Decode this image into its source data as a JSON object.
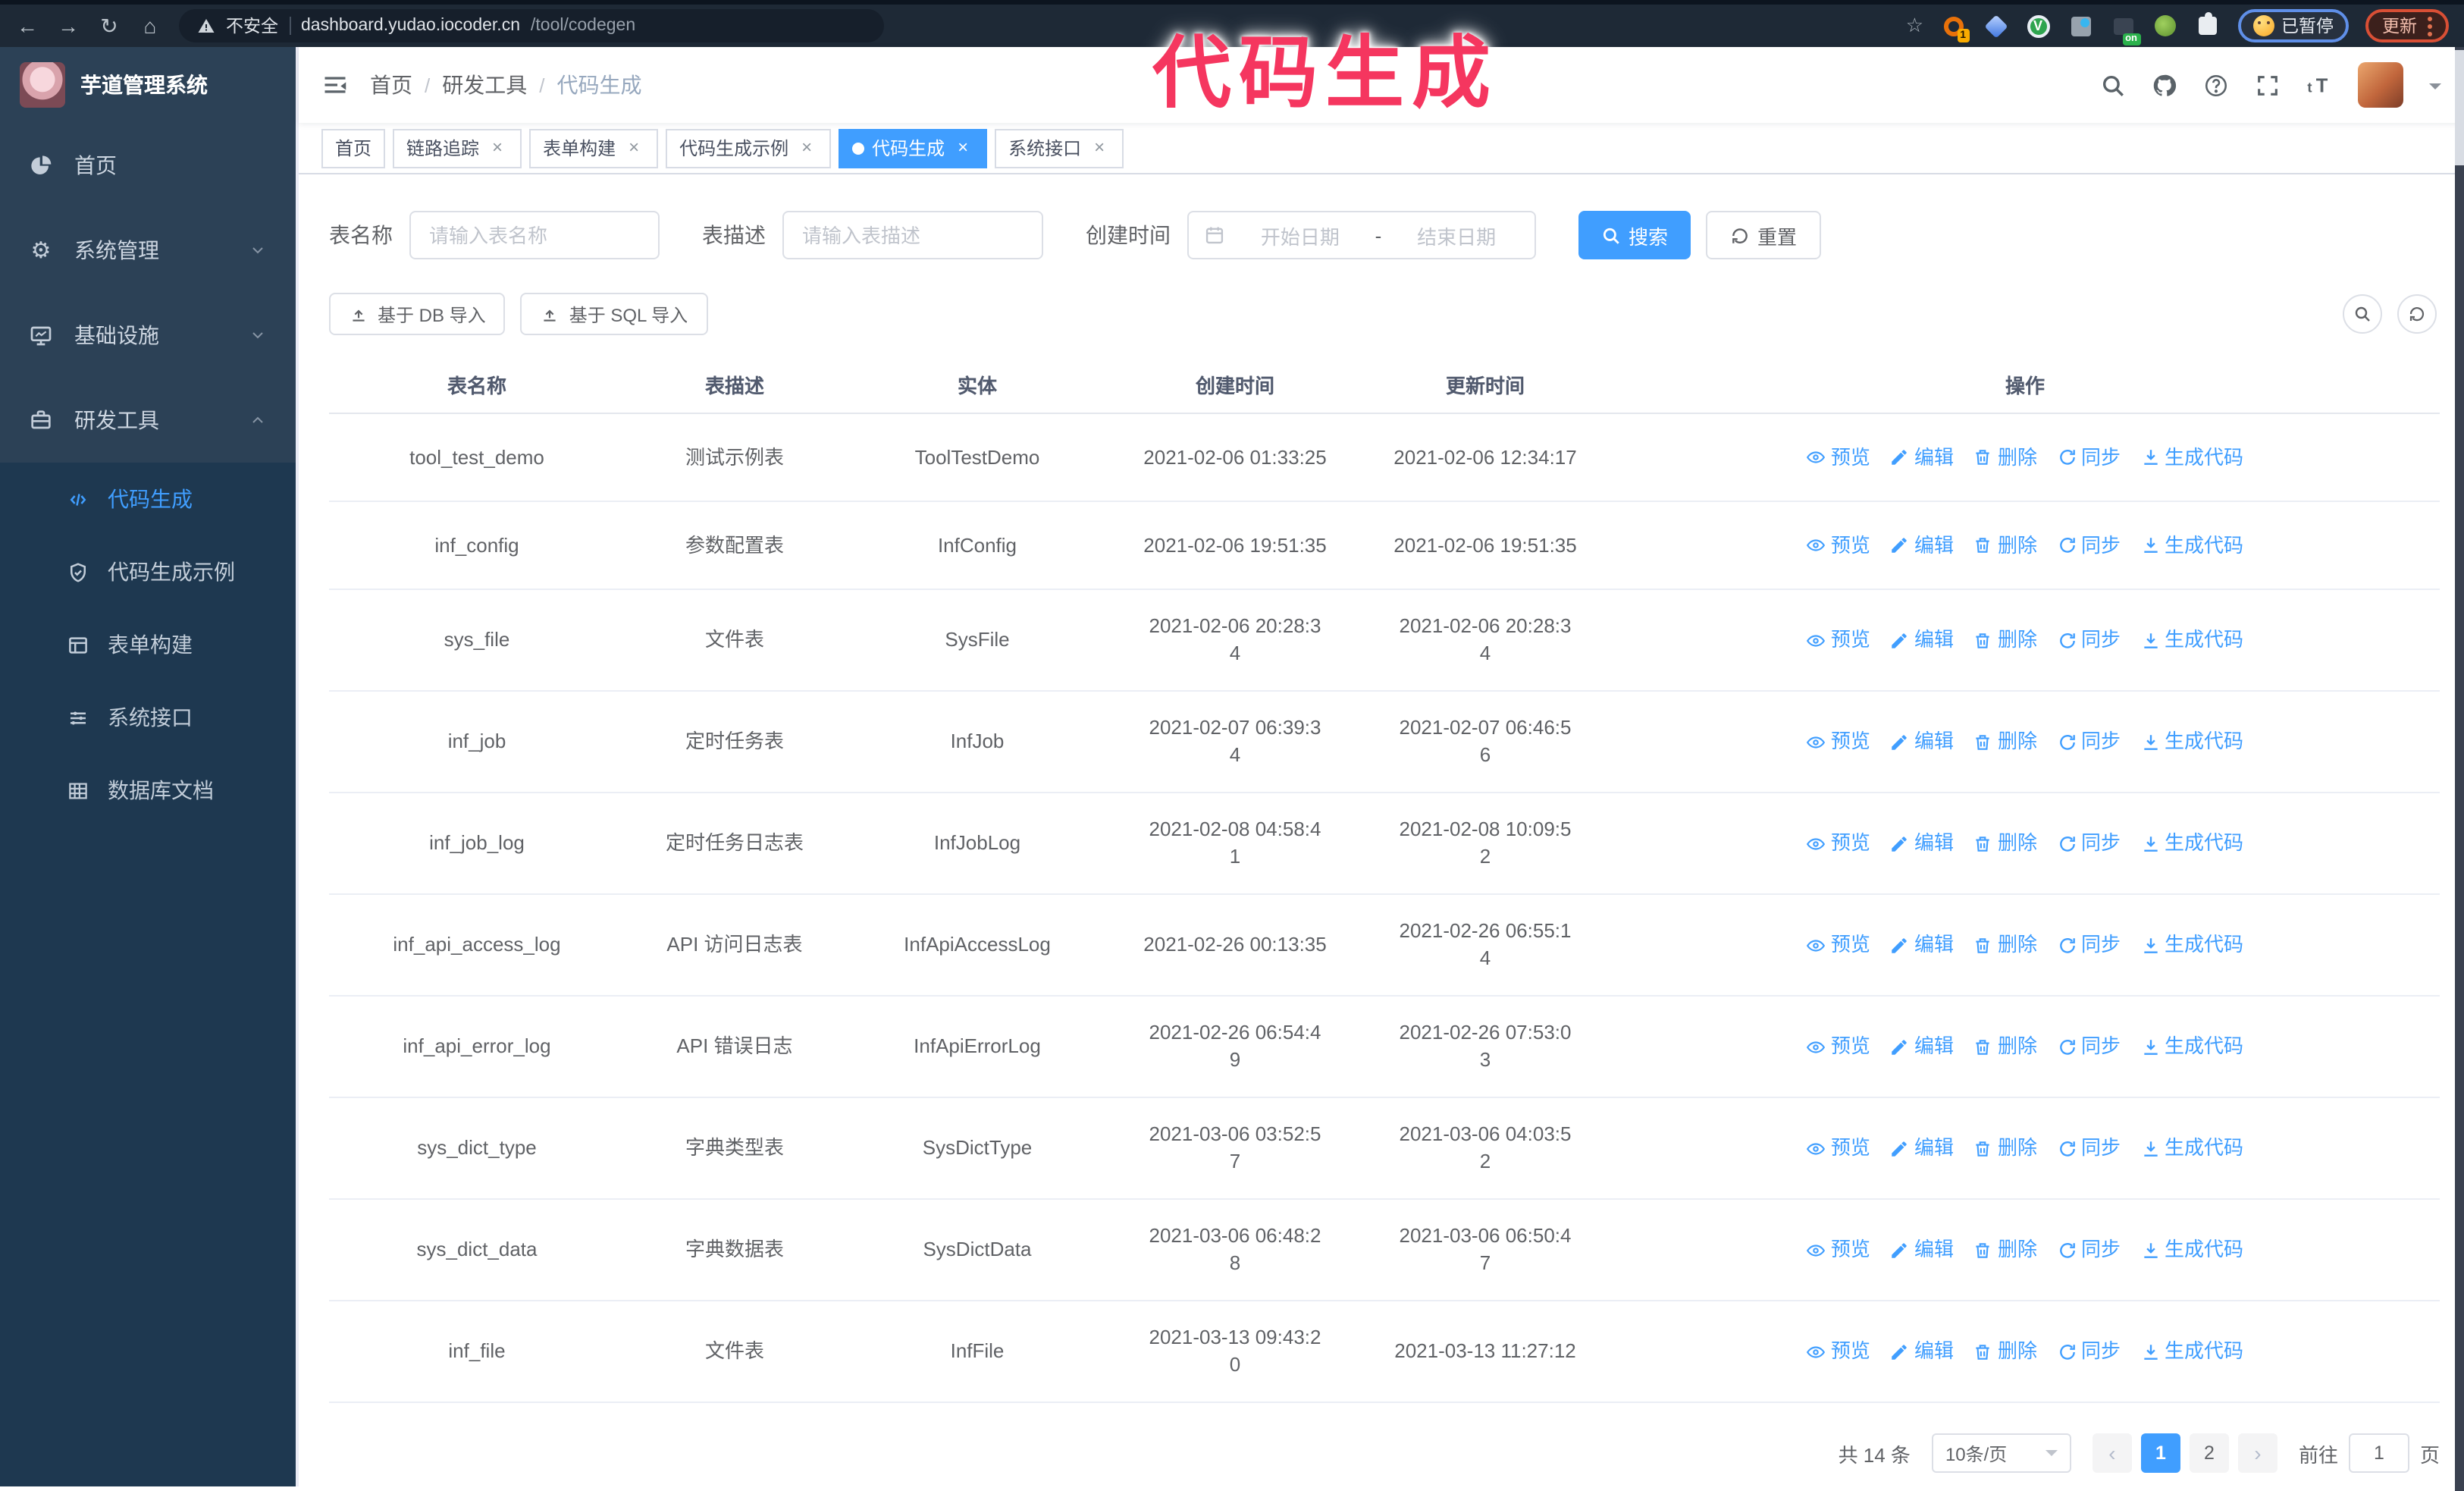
{
  "annotation": "代码生成",
  "browser": {
    "security_label": "不安全",
    "url_host": "dashboard.yudao.iocoder.cn",
    "url_path": "/tool/codegen",
    "extension_badge": "1",
    "extension_on_badge": "on",
    "paused_label": "已暂停",
    "update_label": "更新"
  },
  "sidebar": {
    "title": "芋道管理系统",
    "items": [
      {
        "label": "首页",
        "icon": "dashboard-icon"
      },
      {
        "label": "系统管理",
        "icon": "gear-icon",
        "chevron": "down"
      },
      {
        "label": "基础设施",
        "icon": "infra-icon",
        "chevron": "down"
      },
      {
        "label": "研发工具",
        "icon": "tools-icon",
        "chevron": "up"
      }
    ],
    "subitems": [
      {
        "label": "代码生成",
        "icon": "code-icon",
        "active": true
      },
      {
        "label": "代码生成示例",
        "icon": "example-icon"
      },
      {
        "label": "表单构建",
        "icon": "form-icon"
      },
      {
        "label": "系统接口",
        "icon": "api-icon"
      },
      {
        "label": "数据库文档",
        "icon": "dbdoc-icon"
      }
    ]
  },
  "header": {
    "breadcrumb": [
      "首页",
      "研发工具",
      "代码生成"
    ],
    "sep": "/"
  },
  "tabs": [
    {
      "label": "首页",
      "closable": false,
      "active": false
    },
    {
      "label": "链路追踪",
      "closable": true,
      "active": false
    },
    {
      "label": "表单构建",
      "closable": true,
      "active": false
    },
    {
      "label": "代码生成示例",
      "closable": true,
      "active": false
    },
    {
      "label": "代码生成",
      "closable": true,
      "active": true
    },
    {
      "label": "系统接口",
      "closable": true,
      "active": false
    }
  ],
  "filters": {
    "name_label": "表名称",
    "name_placeholder": "请输入表名称",
    "desc_label": "表描述",
    "desc_placeholder": "请输入表描述",
    "time_label": "创建时间",
    "start_placeholder": "开始日期",
    "range_separator": "-",
    "end_placeholder": "结束日期",
    "search_label": "搜索",
    "reset_label": "重置"
  },
  "toolbar": {
    "db_import_label": "基于 DB 导入",
    "sql_import_label": "基于 SQL 导入"
  },
  "table": {
    "columns": [
      "表名称",
      "表描述",
      "实体",
      "创建时间",
      "更新时间",
      "操作"
    ],
    "actions": [
      "预览",
      "编辑",
      "删除",
      "同步",
      "生成代码"
    ],
    "rows": [
      {
        "name": "tool_test_demo",
        "desc": "测试示例表",
        "entity": "ToolTestDemo",
        "created": "2021-02-06 01:33:25",
        "updated": "2021-02-06 12:34:17"
      },
      {
        "name": "inf_config",
        "desc": "参数配置表",
        "entity": "InfConfig",
        "created": "2021-02-06 19:51:35",
        "updated": "2021-02-06 19:51:35"
      },
      {
        "name": "sys_file",
        "desc": "文件表",
        "entity": "SysFile",
        "created": "2021-02-06 20:28:3\n4",
        "updated": "2021-02-06 20:28:3\n4"
      },
      {
        "name": "inf_job",
        "desc": "定时任务表",
        "entity": "InfJob",
        "created": "2021-02-07 06:39:3\n4",
        "updated": "2021-02-07 06:46:5\n6"
      },
      {
        "name": "inf_job_log",
        "desc": "定时任务日志表",
        "entity": "InfJobLog",
        "created": "2021-02-08 04:58:4\n1",
        "updated": "2021-02-08 10:09:5\n2"
      },
      {
        "name": "inf_api_access_log",
        "desc": "API 访问日志表",
        "entity": "InfApiAccessLog",
        "created": "2021-02-26 00:13:35",
        "updated": "2021-02-26 06:55:1\n4"
      },
      {
        "name": "inf_api_error_log",
        "desc": "API 错误日志",
        "entity": "InfApiErrorLog",
        "created": "2021-02-26 06:54:4\n9",
        "updated": "2021-02-26 07:53:0\n3"
      },
      {
        "name": "sys_dict_type",
        "desc": "字典类型表",
        "entity": "SysDictType",
        "created": "2021-03-06 03:52:5\n7",
        "updated": "2021-03-06 04:03:5\n2"
      },
      {
        "name": "sys_dict_data",
        "desc": "字典数据表",
        "entity": "SysDictData",
        "created": "2021-03-06 06:48:2\n8",
        "updated": "2021-03-06 06:50:4\n7"
      },
      {
        "name": "inf_file",
        "desc": "文件表",
        "entity": "InfFile",
        "created": "2021-03-13 09:43:2\n0",
        "updated": "2021-03-13 11:27:12"
      }
    ]
  },
  "pagination": {
    "total": "共 14 条",
    "page_size": "10条/页",
    "pages": [
      "1",
      "2"
    ],
    "active": "1",
    "goto_label": "前往",
    "goto_value": "1",
    "page_label": "页"
  },
  "icons": {
    "accent_color": "#409EFF",
    "annotation_color": "#f5365f",
    "sidebar_color": "#2c4156",
    "sidebar_sub_color": "#1e3850",
    "names": [
      "back-icon",
      "forward-icon",
      "reload-icon",
      "home-icon",
      "warning-icon",
      "star-icon",
      "search-icon",
      "github-icon",
      "question-icon",
      "fullscreen-icon",
      "fontsize-icon",
      "calendar-icon",
      "upload-icon",
      "eye-icon",
      "edit-icon",
      "delete-icon",
      "sync-icon",
      "download-icon"
    ]
  }
}
